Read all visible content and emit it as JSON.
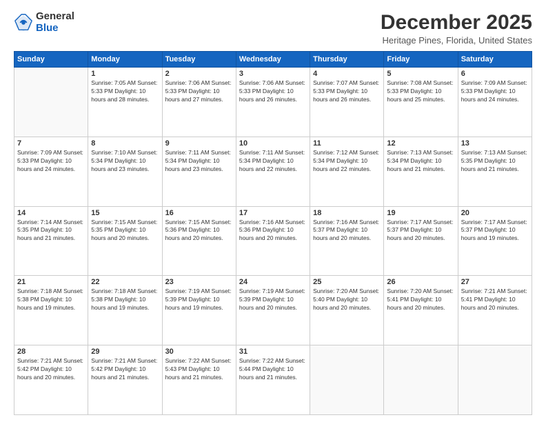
{
  "logo": {
    "general": "General",
    "blue": "Blue"
  },
  "title": "December 2025",
  "location": "Heritage Pines, Florida, United States",
  "days_of_week": [
    "Sunday",
    "Monday",
    "Tuesday",
    "Wednesday",
    "Thursday",
    "Friday",
    "Saturday"
  ],
  "weeks": [
    [
      {
        "day": "",
        "info": ""
      },
      {
        "day": "1",
        "info": "Sunrise: 7:05 AM\nSunset: 5:33 PM\nDaylight: 10 hours\nand 28 minutes."
      },
      {
        "day": "2",
        "info": "Sunrise: 7:06 AM\nSunset: 5:33 PM\nDaylight: 10 hours\nand 27 minutes."
      },
      {
        "day": "3",
        "info": "Sunrise: 7:06 AM\nSunset: 5:33 PM\nDaylight: 10 hours\nand 26 minutes."
      },
      {
        "day": "4",
        "info": "Sunrise: 7:07 AM\nSunset: 5:33 PM\nDaylight: 10 hours\nand 26 minutes."
      },
      {
        "day": "5",
        "info": "Sunrise: 7:08 AM\nSunset: 5:33 PM\nDaylight: 10 hours\nand 25 minutes."
      },
      {
        "day": "6",
        "info": "Sunrise: 7:09 AM\nSunset: 5:33 PM\nDaylight: 10 hours\nand 24 minutes."
      }
    ],
    [
      {
        "day": "7",
        "info": "Sunrise: 7:09 AM\nSunset: 5:33 PM\nDaylight: 10 hours\nand 24 minutes."
      },
      {
        "day": "8",
        "info": "Sunrise: 7:10 AM\nSunset: 5:34 PM\nDaylight: 10 hours\nand 23 minutes."
      },
      {
        "day": "9",
        "info": "Sunrise: 7:11 AM\nSunset: 5:34 PM\nDaylight: 10 hours\nand 23 minutes."
      },
      {
        "day": "10",
        "info": "Sunrise: 7:11 AM\nSunset: 5:34 PM\nDaylight: 10 hours\nand 22 minutes."
      },
      {
        "day": "11",
        "info": "Sunrise: 7:12 AM\nSunset: 5:34 PM\nDaylight: 10 hours\nand 22 minutes."
      },
      {
        "day": "12",
        "info": "Sunrise: 7:13 AM\nSunset: 5:34 PM\nDaylight: 10 hours\nand 21 minutes."
      },
      {
        "day": "13",
        "info": "Sunrise: 7:13 AM\nSunset: 5:35 PM\nDaylight: 10 hours\nand 21 minutes."
      }
    ],
    [
      {
        "day": "14",
        "info": "Sunrise: 7:14 AM\nSunset: 5:35 PM\nDaylight: 10 hours\nand 21 minutes."
      },
      {
        "day": "15",
        "info": "Sunrise: 7:15 AM\nSunset: 5:35 PM\nDaylight: 10 hours\nand 20 minutes."
      },
      {
        "day": "16",
        "info": "Sunrise: 7:15 AM\nSunset: 5:36 PM\nDaylight: 10 hours\nand 20 minutes."
      },
      {
        "day": "17",
        "info": "Sunrise: 7:16 AM\nSunset: 5:36 PM\nDaylight: 10 hours\nand 20 minutes."
      },
      {
        "day": "18",
        "info": "Sunrise: 7:16 AM\nSunset: 5:37 PM\nDaylight: 10 hours\nand 20 minutes."
      },
      {
        "day": "19",
        "info": "Sunrise: 7:17 AM\nSunset: 5:37 PM\nDaylight: 10 hours\nand 20 minutes."
      },
      {
        "day": "20",
        "info": "Sunrise: 7:17 AM\nSunset: 5:37 PM\nDaylight: 10 hours\nand 19 minutes."
      }
    ],
    [
      {
        "day": "21",
        "info": "Sunrise: 7:18 AM\nSunset: 5:38 PM\nDaylight: 10 hours\nand 19 minutes."
      },
      {
        "day": "22",
        "info": "Sunrise: 7:18 AM\nSunset: 5:38 PM\nDaylight: 10 hours\nand 19 minutes."
      },
      {
        "day": "23",
        "info": "Sunrise: 7:19 AM\nSunset: 5:39 PM\nDaylight: 10 hours\nand 19 minutes."
      },
      {
        "day": "24",
        "info": "Sunrise: 7:19 AM\nSunset: 5:39 PM\nDaylight: 10 hours\nand 20 minutes."
      },
      {
        "day": "25",
        "info": "Sunrise: 7:20 AM\nSunset: 5:40 PM\nDaylight: 10 hours\nand 20 minutes."
      },
      {
        "day": "26",
        "info": "Sunrise: 7:20 AM\nSunset: 5:41 PM\nDaylight: 10 hours\nand 20 minutes."
      },
      {
        "day": "27",
        "info": "Sunrise: 7:21 AM\nSunset: 5:41 PM\nDaylight: 10 hours\nand 20 minutes."
      }
    ],
    [
      {
        "day": "28",
        "info": "Sunrise: 7:21 AM\nSunset: 5:42 PM\nDaylight: 10 hours\nand 20 minutes."
      },
      {
        "day": "29",
        "info": "Sunrise: 7:21 AM\nSunset: 5:42 PM\nDaylight: 10 hours\nand 21 minutes."
      },
      {
        "day": "30",
        "info": "Sunrise: 7:22 AM\nSunset: 5:43 PM\nDaylight: 10 hours\nand 21 minutes."
      },
      {
        "day": "31",
        "info": "Sunrise: 7:22 AM\nSunset: 5:44 PM\nDaylight: 10 hours\nand 21 minutes."
      },
      {
        "day": "",
        "info": ""
      },
      {
        "day": "",
        "info": ""
      },
      {
        "day": "",
        "info": ""
      }
    ]
  ]
}
